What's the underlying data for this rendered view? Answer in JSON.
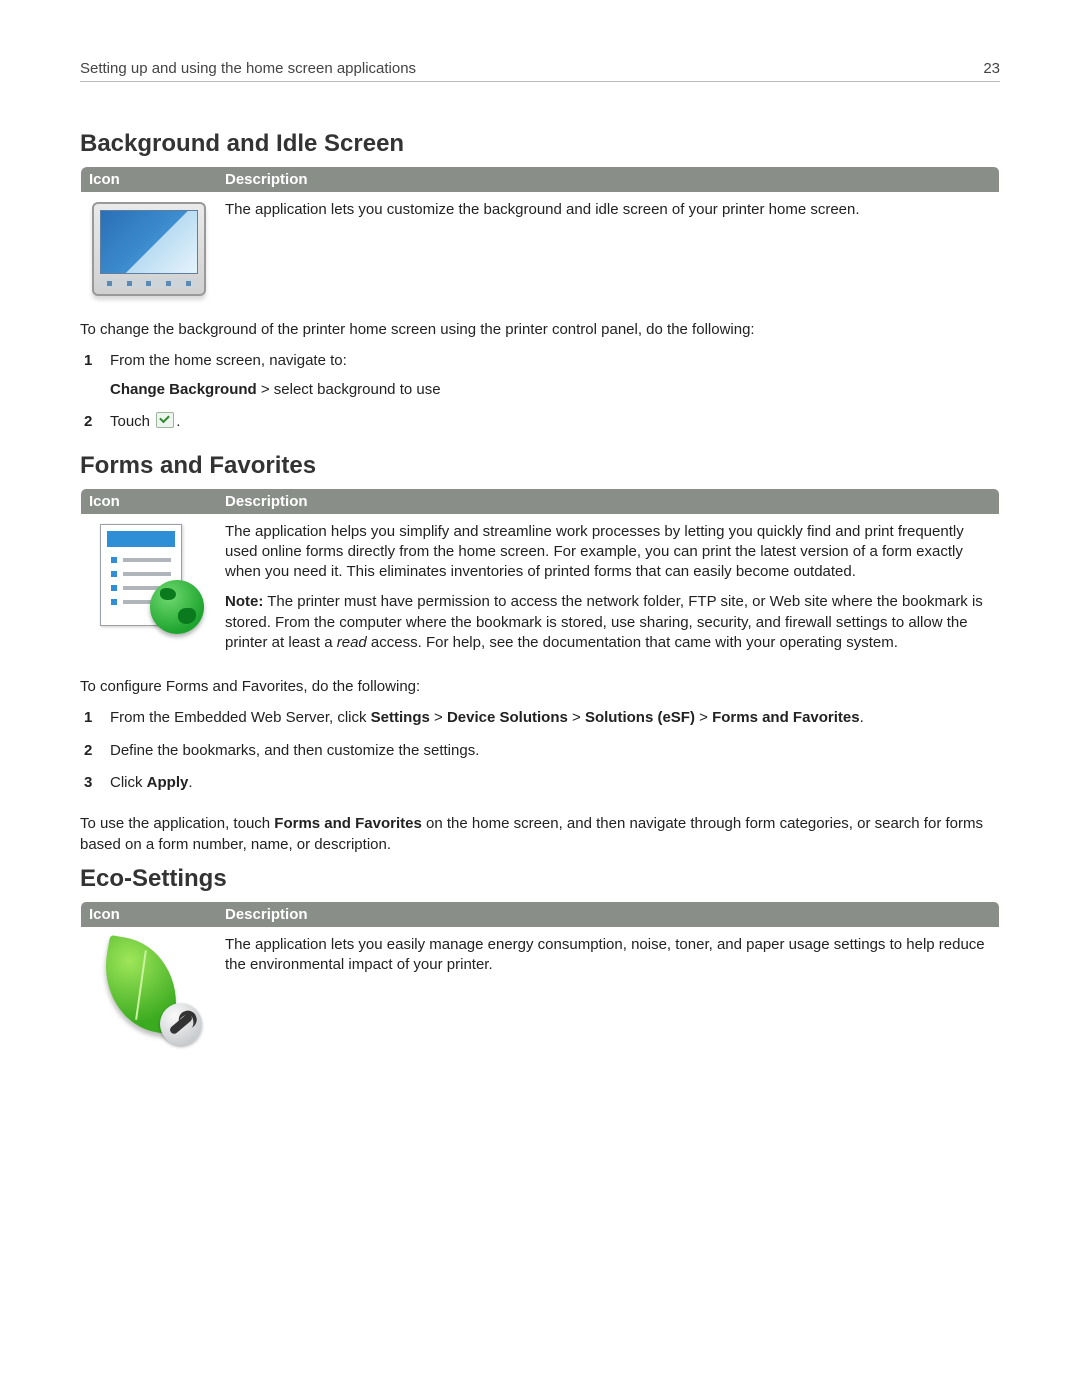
{
  "header": {
    "title": "Setting up and using the home screen applications",
    "page_number": "23"
  },
  "sections": {
    "bg": {
      "heading": "Background and Idle Screen",
      "col_icon": "Icon",
      "col_desc": "Description",
      "desc": "The application lets you customize the background and idle screen of your printer home screen.",
      "intro": "To change the background of the printer home screen using the printer control panel, do the following:",
      "step1_line1": "From the home screen, navigate to:",
      "step1_line2a": "Change Background",
      "step1_line2b": " > select background to use",
      "step2_a": "Touch ",
      "step2_b": "."
    },
    "forms": {
      "heading": "Forms and Favorites",
      "col_icon": "Icon",
      "col_desc": "Description",
      "desc": "The application helps you simplify and streamline work processes by letting you quickly find and print frequently used online forms directly from the home screen. For example, you can print the latest version of a form exactly when you need it. This eliminates inventories of printed forms that can easily become outdated.",
      "note_label": "Note:",
      "note_a": " The printer must have permission to access the network folder, FTP site, or Web site where the bookmark is stored. From the computer where the bookmark is stored, use sharing, security, and firewall settings to allow the printer at least a ",
      "note_read": "read",
      "note_b": " access. For help, see the documentation that came with your operating system.",
      "intro": "To configure Forms and Favorites, do the following:",
      "s1a": "From the Embedded Web Server, click ",
      "s1_settings": "Settings",
      "s1_gt1": " > ",
      "s1_dev": "Device Solutions",
      "s1_gt2": " > ",
      "s1_sol": "Solutions (eSF)",
      "s1_gt3": " > ",
      "s1_ff": "Forms and Favorites",
      "s1_end": ".",
      "s2": "Define the bookmarks, and then customize the settings.",
      "s3a": "Click ",
      "s3b": "Apply",
      "s3c": ".",
      "use_a": "To use the application, touch ",
      "use_b": "Forms and Favorites",
      "use_c": " on the home screen, and then navigate through form categories, or search for forms based on a form number, name, or description."
    },
    "eco": {
      "heading": "Eco‑Settings",
      "col_icon": "Icon",
      "col_desc": "Description",
      "desc": "The application lets you easily manage energy consumption, noise, toner, and paper usage settings to help reduce the environmental impact of your printer."
    }
  }
}
